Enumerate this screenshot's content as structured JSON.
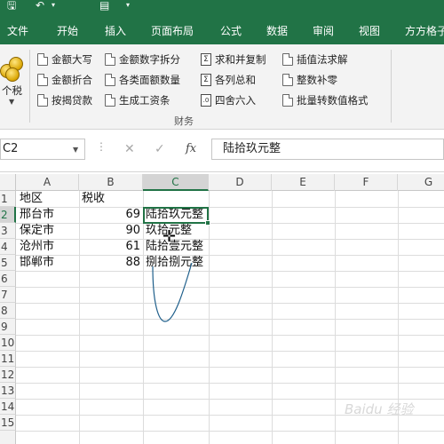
{
  "ribbon_tabs": [
    "文件",
    "开始",
    "插入",
    "页面布局",
    "公式",
    "数据",
    "审阅",
    "视图",
    "方方格子"
  ],
  "ribbon": {
    "big_button": {
      "label": "个税",
      "icon": "coins-icon"
    },
    "items": [
      {
        "label": "金额大写",
        "icon": "page-icon"
      },
      {
        "label": "金额折合",
        "icon": "page-icon"
      },
      {
        "label": "按揭贷款",
        "icon": "page-icon"
      },
      {
        "label": "金额数字拆分",
        "icon": "page-icon"
      },
      {
        "label": "各类面额数量",
        "icon": "page-icon"
      },
      {
        "label": "生成工资条",
        "icon": "page-icon"
      },
      {
        "label": "求和并复制",
        "icon": "sigma-icon"
      },
      {
        "label": "各列总和",
        "icon": "sigma-icon"
      },
      {
        "label": "四舍六入",
        "icon": "round-icon"
      },
      {
        "label": "插值法求解",
        "icon": "page-icon"
      },
      {
        "label": "整数补零",
        "icon": "page-icon"
      },
      {
        "label": "批量转数值格式",
        "icon": "page-icon"
      }
    ],
    "group_label": "财务"
  },
  "formula_bar": {
    "name_box": "C2",
    "fx_label": "fx",
    "formula": "陆拾玖元整"
  },
  "sheet": {
    "columns": [
      "A",
      "B",
      "C",
      "D",
      "E",
      "F",
      "G"
    ],
    "rows": [
      "1",
      "2",
      "3",
      "4",
      "5",
      "6",
      "7",
      "8",
      "9",
      "10",
      "11",
      "12",
      "13",
      "14",
      "15"
    ],
    "selected_column": "C",
    "selected_row": "2",
    "active_cell": "C2",
    "cells": [
      {
        "ref": "A1",
        "value": "地区"
      },
      {
        "ref": "B1",
        "value": "税收"
      },
      {
        "ref": "C1",
        "value": ""
      },
      {
        "ref": "A2",
        "value": "邢台市"
      },
      {
        "ref": "B2",
        "value": "69"
      },
      {
        "ref": "C2",
        "value": "陆拾玖元整"
      },
      {
        "ref": "A3",
        "value": "保定市"
      },
      {
        "ref": "B3",
        "value": "90"
      },
      {
        "ref": "C3",
        "value": "玖拾元整"
      },
      {
        "ref": "A4",
        "value": "沧州市"
      },
      {
        "ref": "B4",
        "value": "61"
      },
      {
        "ref": "C4",
        "value": "陆拾壹元整"
      },
      {
        "ref": "A5",
        "value": "邯郸市"
      },
      {
        "ref": "B5",
        "value": "88"
      },
      {
        "ref": "C5",
        "value": "捌拾捌元整"
      }
    ]
  },
  "watermark": "Baidu 经验",
  "colors": {
    "accent": "#217346",
    "grid": "#dcdcdc",
    "header_bg": "#f2f2f2"
  }
}
